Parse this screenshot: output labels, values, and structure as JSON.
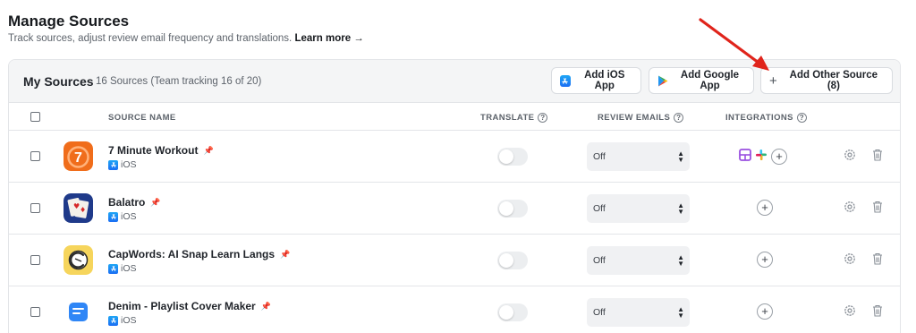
{
  "page": {
    "title": "Manage Sources",
    "subtitle": "Track sources, adjust review email frequency and translations.",
    "learn_more": "Learn more →"
  },
  "card": {
    "title": "My Sources",
    "meta": "16 Sources (Team tracking 16 of 20)",
    "buttons": {
      "ios": "Add iOS App",
      "google": "Add Google App",
      "other": "Add Other Source (8)"
    }
  },
  "columns": {
    "source_name": "SOURCE NAME",
    "translate": "TRANSLATE",
    "review_emails": "REVIEW EMAILS",
    "integrations": "INTEGRATIONS"
  },
  "rows": [
    {
      "name": "7 Minute Workout",
      "platform": "iOS",
      "pinned": true,
      "translate": false,
      "review_emails": "Off",
      "integrations": [
        "notion-icon",
        "slack-icon"
      ]
    },
    {
      "name": "Balatro",
      "platform": "iOS",
      "pinned": false,
      "translate": false,
      "review_emails": "Off",
      "integrations": []
    },
    {
      "name": "CapWords: AI Snap Learn Langs",
      "platform": "iOS",
      "pinned": false,
      "translate": false,
      "review_emails": "Off",
      "integrations": []
    },
    {
      "name": "Denim - Playlist Cover Maker",
      "platform": "iOS",
      "pinned": false,
      "translate": false,
      "review_emails": "Off",
      "integrations": []
    }
  ],
  "colors": {
    "accent_arrow": "#e0241b",
    "pin_active": "#e8720c",
    "app_store_blue": "#1b6ef3"
  }
}
